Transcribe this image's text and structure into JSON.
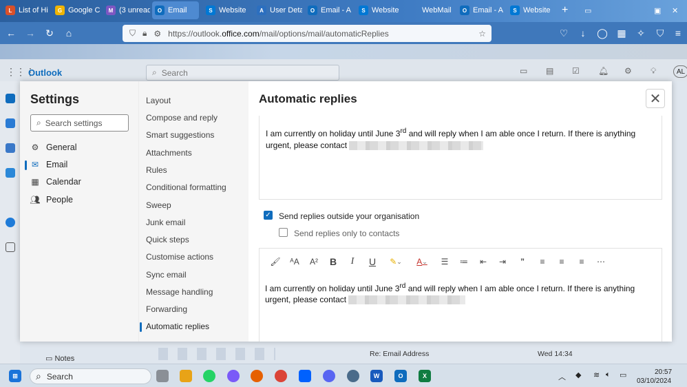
{
  "browser": {
    "tabs": [
      {
        "label": "List of Hi",
        "color": "#d9502a",
        "glyph": "L"
      },
      {
        "label": "Google C",
        "color": "#f0b400",
        "glyph": "G"
      },
      {
        "label": "(3 unread",
        "color": "#7e57c2",
        "glyph": "M"
      },
      {
        "label": "Email",
        "color": "#0f6cbd",
        "glyph": "O"
      },
      {
        "label": "Website",
        "color": "#0078d4",
        "glyph": "S"
      },
      {
        "label": "User Deta",
        "color": "#2c6fbf",
        "glyph": "A"
      },
      {
        "label": "Email - A",
        "color": "#0f6cbd",
        "glyph": "O"
      },
      {
        "label": "Website",
        "color": "#0078d4",
        "glyph": "S"
      },
      {
        "label": "WebMail",
        "color": "#6b8fc4",
        "glyph": ""
      },
      {
        "label": "Email - A",
        "color": "#0f6cbd",
        "glyph": "O"
      },
      {
        "label": "Website",
        "color": "#0078d4",
        "glyph": "S"
      }
    ],
    "new_tab": "+",
    "url_prefix": "https://outlook.",
    "url_domain": "office.com",
    "url_path": "/mail/options/mail/automaticReplies"
  },
  "outlook": {
    "app_name": "Outlook",
    "search_placeholder": "Search",
    "avatar": "AL"
  },
  "settings": {
    "title": "Settings",
    "search_placeholder": "Search settings",
    "nav": [
      {
        "label": "General",
        "icon": "gear-icon"
      },
      {
        "label": "Email",
        "icon": "mail-icon"
      },
      {
        "label": "Calendar",
        "icon": "calendar-icon"
      },
      {
        "label": "People",
        "icon": "people-icon"
      }
    ],
    "sub_nav": [
      "Layout",
      "Compose and reply",
      "Smart suggestions",
      "Attachments",
      "Rules",
      "Conditional formatting",
      "Sweep",
      "Junk email",
      "Quick steps",
      "Customise actions",
      "Sync email",
      "Message handling",
      "Forwarding",
      "Automatic replies"
    ]
  },
  "auto_replies": {
    "heading": "Automatic replies",
    "inside_message_a": "I am currently on holiday until June 3",
    "inside_message_sup": "rd",
    "inside_message_b": " and will reply when I am able once I return.  If there is anything urgent, please contact",
    "send_outside_label": "Send replies outside your organisation",
    "send_outside_checked": true,
    "contacts_only_label": "Send replies only to contacts",
    "contacts_only_checked": false,
    "outside_message_a": "I am currently on holiday until June 3",
    "outside_message_sup": "rd",
    "outside_message_b": " and will reply when I am able once I return.    If there is anything urgent, please contact"
  },
  "background": {
    "notes_label": "Notes",
    "mail_subject": "Re: Email Address",
    "mail_time": "Wed 14:34"
  },
  "taskbar": {
    "search_label": "Search",
    "time": "20:57",
    "date": "03/10/2024"
  },
  "colors": {
    "accent": "#0f6cbd"
  }
}
